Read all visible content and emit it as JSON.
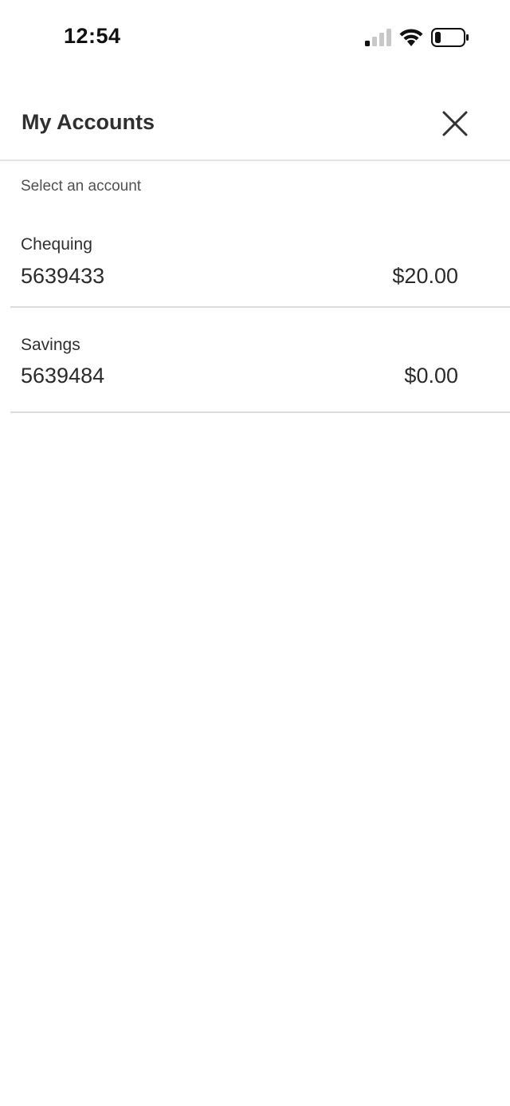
{
  "status_bar": {
    "time": "12:54",
    "icons": [
      "signal-icon",
      "wifi-icon",
      "battery-icon"
    ]
  },
  "header": {
    "title": "My Accounts",
    "close_icon": "close-icon"
  },
  "main": {
    "subtitle": "Select an account",
    "accounts": [
      {
        "name": "Chequing",
        "number": "5639433",
        "balance": "$20.00"
      },
      {
        "name": "Savings",
        "number": "5639484",
        "balance": "$0.00"
      }
    ]
  },
  "colors": {
    "background": "#ffffff",
    "text": "#2b2b2b",
    "divider": "#dcdcdc"
  }
}
